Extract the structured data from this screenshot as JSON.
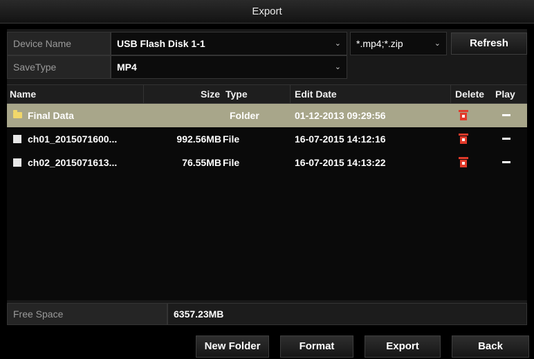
{
  "window": {
    "title": "Export"
  },
  "device": {
    "label": "Device Name",
    "value": "USB Flash Disk 1-1",
    "filter": "*.mp4;*.zip",
    "refresh_label": "Refresh"
  },
  "savetype": {
    "label": "SaveType",
    "value": "MP4"
  },
  "table": {
    "headers": {
      "name": "Name",
      "size": "Size",
      "type": "Type",
      "edit_date": "Edit Date",
      "delete": "Delete",
      "play": "Play"
    },
    "rows": [
      {
        "name": "Final Data",
        "size": "",
        "type": "Folder",
        "date": "01-12-2013 09:29:56",
        "icon": "folder-icon",
        "selected": true
      },
      {
        "name": "ch01_2015071600...",
        "size": "992.56MB",
        "type": "File",
        "date": "16-07-2015 14:12:16",
        "icon": "file-icon",
        "selected": false
      },
      {
        "name": "ch02_2015071613...",
        "size": "76.55MB",
        "type": "File",
        "date": "16-07-2015 14:13:22",
        "icon": "file-icon",
        "selected": false
      }
    ]
  },
  "free_space": {
    "label": "Free Space",
    "value": "6357.23MB"
  },
  "actions": {
    "new_folder": "New Folder",
    "format": "Format",
    "export": "Export",
    "back": "Back"
  },
  "colors": {
    "selected_row": "#a8a68a",
    "delete_icon": "#e23a2a",
    "folder_icon": "#f1d76a"
  }
}
